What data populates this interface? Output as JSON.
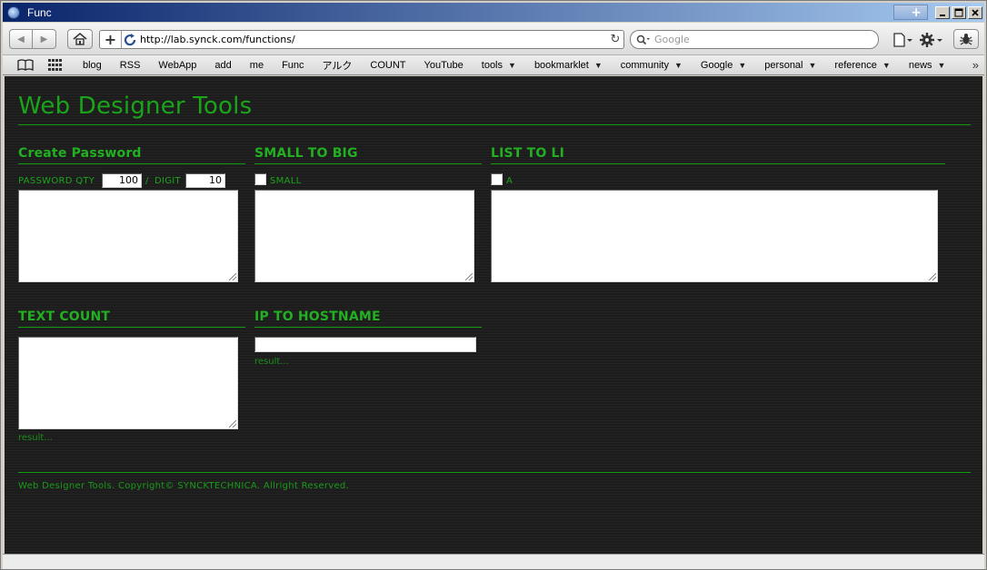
{
  "window": {
    "title": "Func",
    "newtab_label": "+",
    "minimize_label": "_",
    "maximize_label": "□",
    "close_label": "✕"
  },
  "toolbar": {
    "back_label": "◀",
    "forward_label": "▶",
    "add_label": "+",
    "url": "http://lab.synck.com/functions/",
    "reload_label": "↻",
    "search_placeholder": "Google"
  },
  "bookmarks": {
    "items": [
      {
        "label": "blog",
        "dropdown": false
      },
      {
        "label": "RSS",
        "dropdown": false
      },
      {
        "label": "WebApp",
        "dropdown": false
      },
      {
        "label": "add",
        "dropdown": false
      },
      {
        "label": "me",
        "dropdown": false
      },
      {
        "label": "Func",
        "dropdown": false
      },
      {
        "label": "アルク",
        "dropdown": false
      },
      {
        "label": "COUNT",
        "dropdown": false
      },
      {
        "label": "YouTube",
        "dropdown": false
      },
      {
        "label": "tools",
        "dropdown": true
      },
      {
        "label": "bookmarklet",
        "dropdown": true
      },
      {
        "label": "community",
        "dropdown": true
      },
      {
        "label": "Google",
        "dropdown": true
      },
      {
        "label": "personal",
        "dropdown": true
      },
      {
        "label": "reference",
        "dropdown": true
      },
      {
        "label": "news",
        "dropdown": true
      }
    ],
    "more_label": "»",
    "caret": "▼"
  },
  "page": {
    "site_title": "Web Designer Tools",
    "create_password": {
      "heading": "Create Password",
      "qty_label": "PASSWORD QTY",
      "qty_value": "100",
      "separator": "/",
      "digit_label": "DIGIT",
      "digit_value": "10"
    },
    "small_to_big": {
      "heading": "SMALL TO BIG",
      "checkbox_label": "SMALL"
    },
    "list_to_li": {
      "heading": "LIST TO LI",
      "checkbox_label": "A"
    },
    "text_count": {
      "heading": "TEXT COUNT",
      "result": "result..."
    },
    "ip_to_hostname": {
      "heading": "IP TO HOSTNAME",
      "result": "result..."
    },
    "footer": "Web Designer Tools. Copyright© SYNCKTECHNICA. Allright Reserved."
  },
  "colors": {
    "accent_green": "#1aa01a",
    "page_background": "#1f1f1f",
    "titlebar": "#0a246a"
  }
}
